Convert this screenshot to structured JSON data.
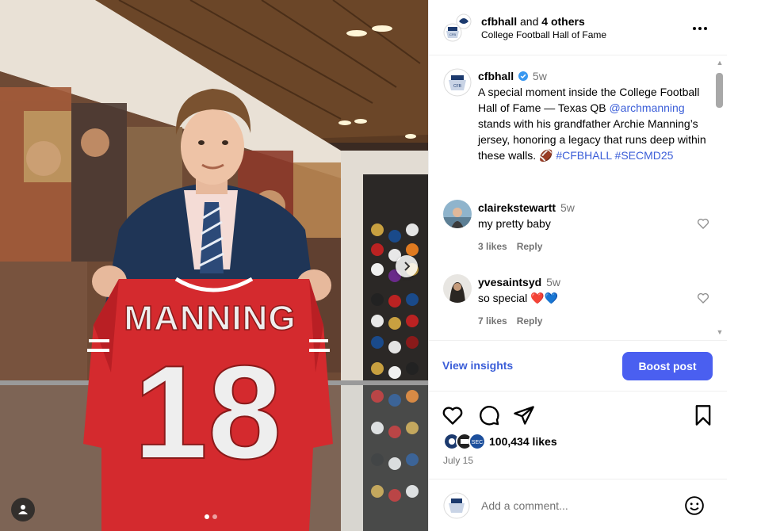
{
  "photo": {
    "jersey_name": "MANNING",
    "jersey_number": "18",
    "carousel_dots": 2,
    "active_dot": 0
  },
  "header": {
    "username": "cfbhall",
    "collab_connector": " and ",
    "collab_others": "4 others",
    "subtitle": "College Football Hall of Fame"
  },
  "caption": {
    "username": "cfbhall",
    "time": "5w",
    "text_before_mention": "A special moment inside the College Football Hall of Fame — Texas QB ",
    "mention": "@archmanning",
    "text_after_mention": " stands with his grandfather Archie Manning’s jersey, honoring a legacy that runs deep within these walls. 🏈 ",
    "hashtags": "#CFBHALL #SECMD25"
  },
  "comments": [
    {
      "username": "clairekstewartt",
      "time": "5w",
      "text": "my pretty baby",
      "likes": "3 likes",
      "reply": "Reply"
    },
    {
      "username": "yvesaintsyd",
      "time": "5w",
      "text": "so special ❤️💙",
      "likes": "7 likes",
      "reply": "Reply"
    }
  ],
  "insights": {
    "view_label": "View insights",
    "boost_label": "Boost post"
  },
  "engagement": {
    "likes": "100,434 likes",
    "date": "July 15"
  },
  "add_comment": {
    "placeholder": "Add a comment..."
  },
  "colors": {
    "accent": "#4a5ff0",
    "link": "#3b5ed8",
    "jersey_red": "#d42a2e",
    "heart_red": "#ed1c5a",
    "heart_blue": "#3d7bd9"
  }
}
